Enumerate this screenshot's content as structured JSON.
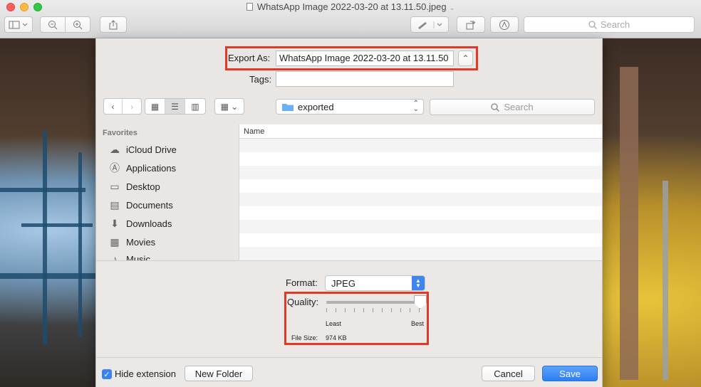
{
  "window": {
    "title": "WhatsApp Image 2022-03-20 at 13.11.50.jpeg",
    "search_placeholder": "Search"
  },
  "sheet": {
    "export_as_label": "Export As:",
    "export_as_value": "WhatsApp Image 2022-03-20 at 13.11.50",
    "tags_label": "Tags:",
    "tags_value": "",
    "location": "exported",
    "search_placeholder": "Search",
    "sidebar": {
      "heading": "Favorites",
      "items": [
        {
          "label": "iCloud Drive",
          "icon": "cloud-icon"
        },
        {
          "label": "Applications",
          "icon": "applications-icon"
        },
        {
          "label": "Desktop",
          "icon": "desktop-icon"
        },
        {
          "label": "Documents",
          "icon": "documents-icon"
        },
        {
          "label": "Downloads",
          "icon": "downloads-icon"
        },
        {
          "label": "Movies",
          "icon": "movies-icon"
        },
        {
          "label": "Music",
          "icon": "music-icon"
        }
      ]
    },
    "file_list": {
      "column_name": "Name"
    },
    "format_label": "Format:",
    "format_value": "JPEG",
    "quality_label": "Quality:",
    "quality_level": 1.0,
    "quality_least": "Least",
    "quality_best": "Best",
    "file_size_label": "File Size:",
    "file_size_value": "974 KB",
    "hide_extension_label": "Hide extension",
    "hide_extension_checked": true,
    "new_folder_label": "New Folder",
    "cancel_label": "Cancel",
    "save_label": "Save"
  },
  "colors": {
    "highlight": "#e03a26",
    "accent": "#3b83f3"
  }
}
